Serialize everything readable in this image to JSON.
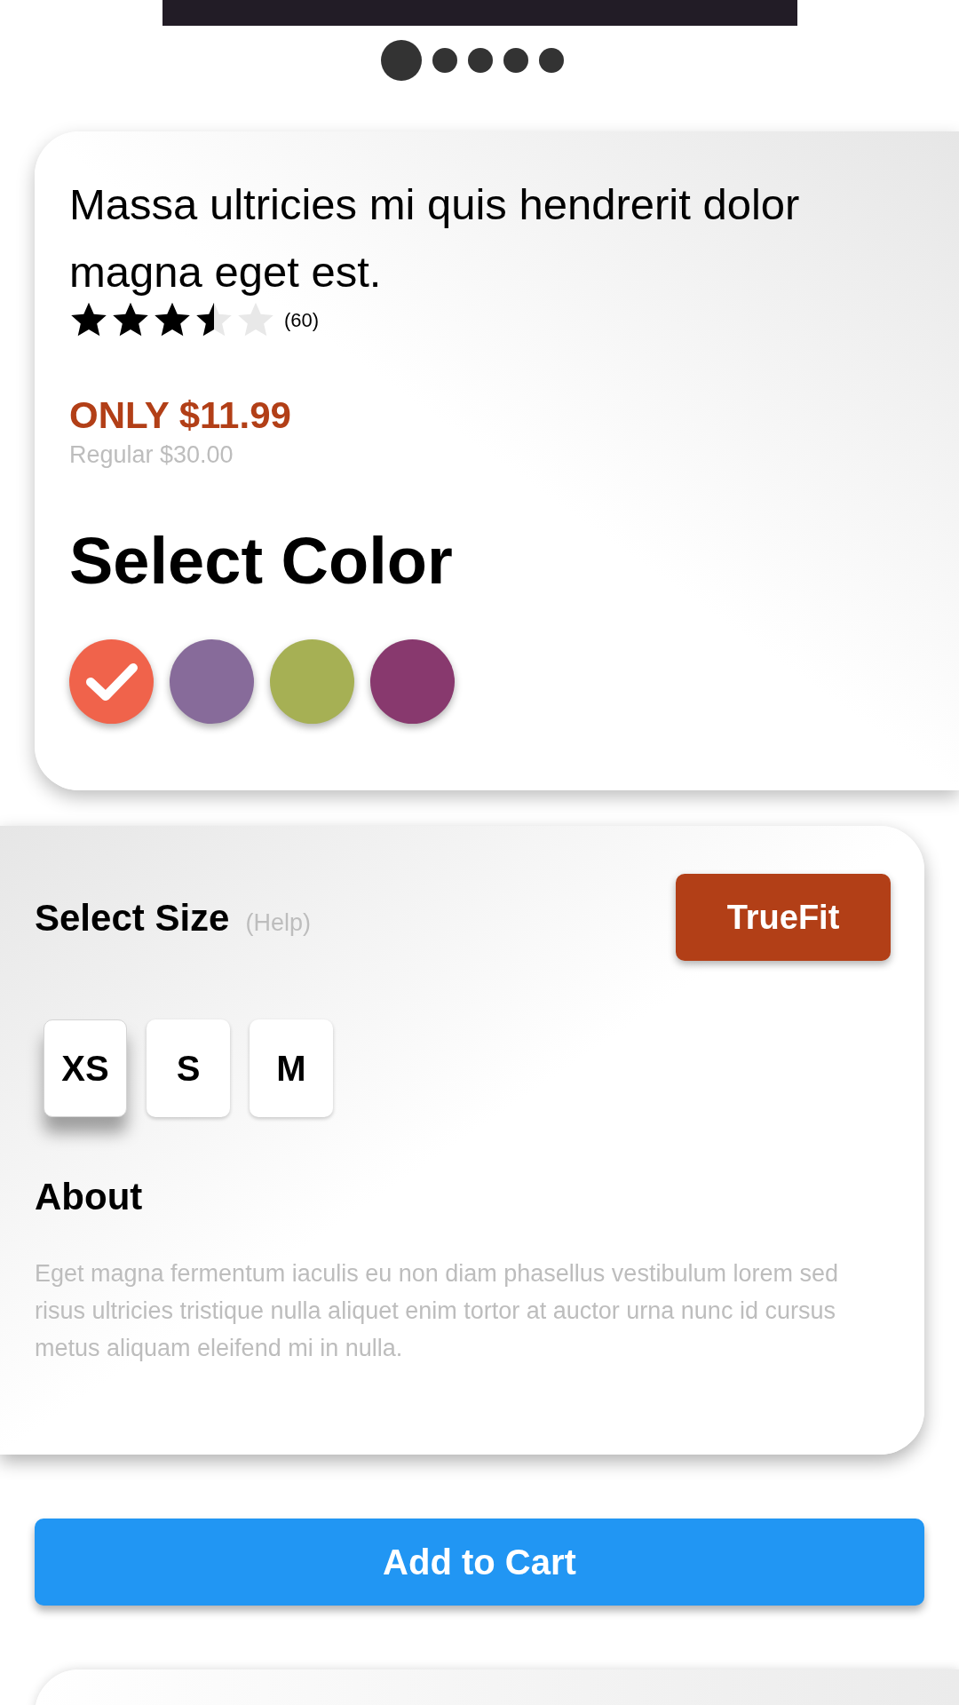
{
  "carousel": {
    "dots": [
      {
        "selected": true
      },
      {
        "selected": false
      },
      {
        "selected": false
      },
      {
        "selected": false
      },
      {
        "selected": false
      }
    ]
  },
  "product": {
    "title": "Massa ultricies mi quis hendrerit dolor magna eget est.",
    "stars": 3.5,
    "review_count": "(60)",
    "sale_price": "ONLY $11.99",
    "regular_price": "Regular $30.00"
  },
  "color_picker": {
    "heading": "Select Color",
    "swatches": [
      {
        "color": "#f0634b",
        "selected": true
      },
      {
        "color": "#876b9a",
        "selected": false
      },
      {
        "color": "#a6b054",
        "selected": false
      },
      {
        "color": "#88396e",
        "selected": false
      }
    ]
  },
  "size_picker": {
    "heading": "Select Size",
    "help_link": "(Help)",
    "truefit_button": "TrueFit",
    "sizes": [
      {
        "label": "XS",
        "selected": true
      },
      {
        "label": "S",
        "selected": false
      },
      {
        "label": "M",
        "selected": false
      }
    ]
  },
  "about": {
    "heading": "About",
    "text": "Eget magna fermentum iaculis eu non diam phasellus vestibulum lorem sed risus ultricies tristique nulla aliquet enim tortor at auctor urna nunc id cursus metus aliquam eleifend mi in nulla."
  },
  "add_to_cart_button": "Add to Cart"
}
